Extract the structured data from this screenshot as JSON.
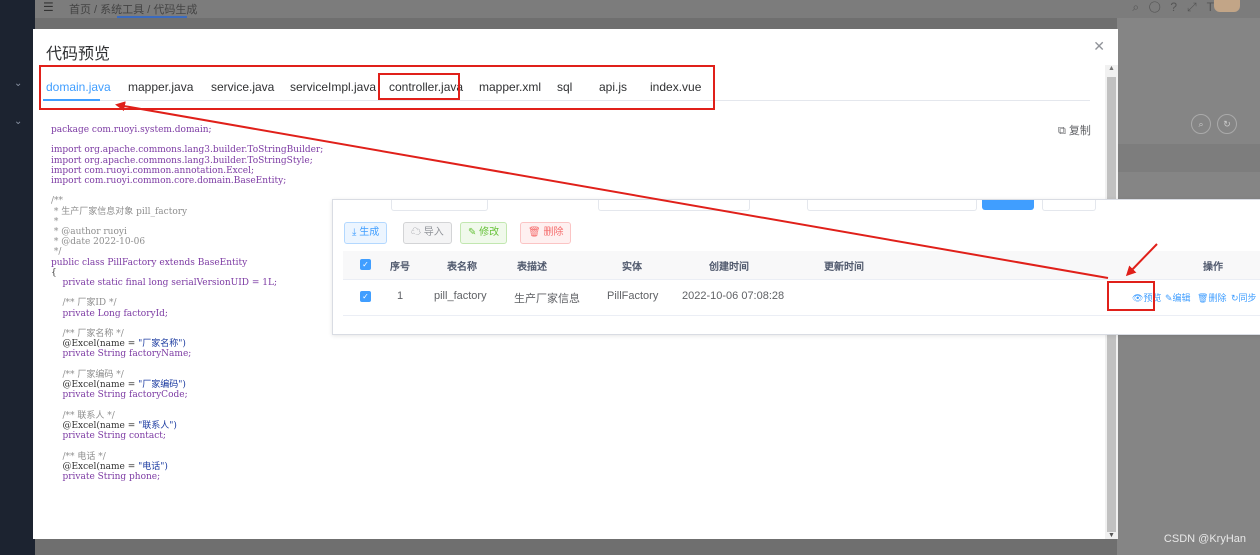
{
  "header": {
    "breadcrumb": "首页 / 系统工具 / 代码生成"
  },
  "dialog": {
    "title": "代码预览",
    "close_icon": "close-icon",
    "copy_label": "复制",
    "tabs": [
      {
        "label": "domain.java",
        "active": true
      },
      {
        "label": "mapper.java"
      },
      {
        "label": "service.java"
      },
      {
        "label": "serviceImpl.java"
      },
      {
        "label": "controller.java"
      },
      {
        "label": "mapper.xml"
      },
      {
        "label": "sql"
      },
      {
        "label": "api.js"
      },
      {
        "label": "index.vue"
      }
    ],
    "code": {
      "l1": "package com.ruoyi.system.domain;",
      "l2": "import org.apache.commons.lang3.builder.ToStringBuilder;",
      "l3": "import org.apache.commons.lang3.builder.ToStringStyle;",
      "l4": "import com.ruoyi.common.annotation.Excel;",
      "l5": "import com.ruoyi.common.core.domain.BaseEntity;",
      "l6": "/**",
      "l7": " * 生产厂家信息对象 pill_factory",
      "l8": " *",
      "l9": " * @author ruoyi",
      "l10": " * @date 2022-10-06",
      "l11": " */",
      "l12": "public class PillFactory extends BaseEntity",
      "l13": "{",
      "l14": "    private static final long serialVersionUID = 1L;",
      "l15": "    /** 厂家ID */",
      "l16": "    private Long factoryId;",
      "l17": "    /** 厂家名称 */",
      "l18a": "    @Excel(name = ",
      "l18b": "\"厂家名称\")",
      "l19": "    private String factoryName;",
      "l20": "    /** 厂家编码 */",
      "l21a": "    @Excel(name = ",
      "l21b": "\"厂家编码\")",
      "l22": "    private String factoryCode;",
      "l23": "    /** 联系人 */",
      "l24a": "    @Excel(name = ",
      "l24b": "\"联系人\")",
      "l25": "    private String contact;",
      "l26": "    /** 电话 */",
      "l27a": "    @Excel(name = ",
      "l27b": "\"电话\")",
      "l28": "    private String phone;"
    }
  },
  "toolbar": {
    "generate": "生成",
    "import": "导入",
    "edit": "修改",
    "delete": "删除"
  },
  "table": {
    "headers": [
      "序号",
      "表名称",
      "表描述",
      "实体",
      "创建时间",
      "更新时间",
      "操作"
    ],
    "rows": [
      {
        "index": "1",
        "table_name": "pill_factory",
        "table_desc": "生产厂家信息",
        "entity": "PillFactory",
        "created": "2022-10-06 07:08:28",
        "updated": "",
        "actions": [
          "预览",
          "编辑",
          "删除",
          "同步"
        ]
      }
    ]
  },
  "annotation_color": "#e0201a",
  "accent": "#409eff",
  "watermark": "CSDN @KryHan"
}
